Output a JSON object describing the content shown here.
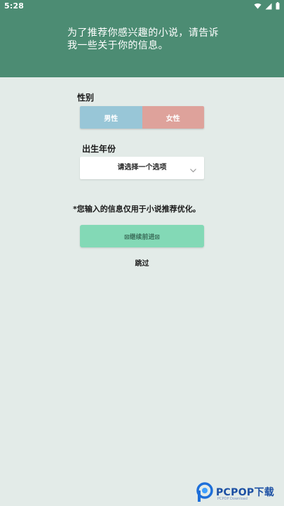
{
  "status_bar": {
    "time": "5:28",
    "icons": [
      "wifi-icon",
      "signal-icon",
      "battery-icon"
    ]
  },
  "header": {
    "prompt": "为了推荐你感兴趣的小说，请告诉我一些关于你的信息。"
  },
  "gender": {
    "label": "性别",
    "options": [
      "男性",
      "女性"
    ]
  },
  "birth_year": {
    "label": "出生年份",
    "placeholder": "请选择一个选项"
  },
  "privacy_note": "*您输入的信息仅用于小说推荐优化。",
  "continue_button": "⊠继续前进⊠",
  "skip": "跳过",
  "watermark": {
    "brand": "PCPOP下载",
    "sub": "PCPOP Download"
  },
  "colors": {
    "header_bg": "#4c8c73",
    "page_bg": "#e3ebe8",
    "male": "#98c6d7",
    "female": "#dea29b",
    "continue": "#83d9b6"
  }
}
